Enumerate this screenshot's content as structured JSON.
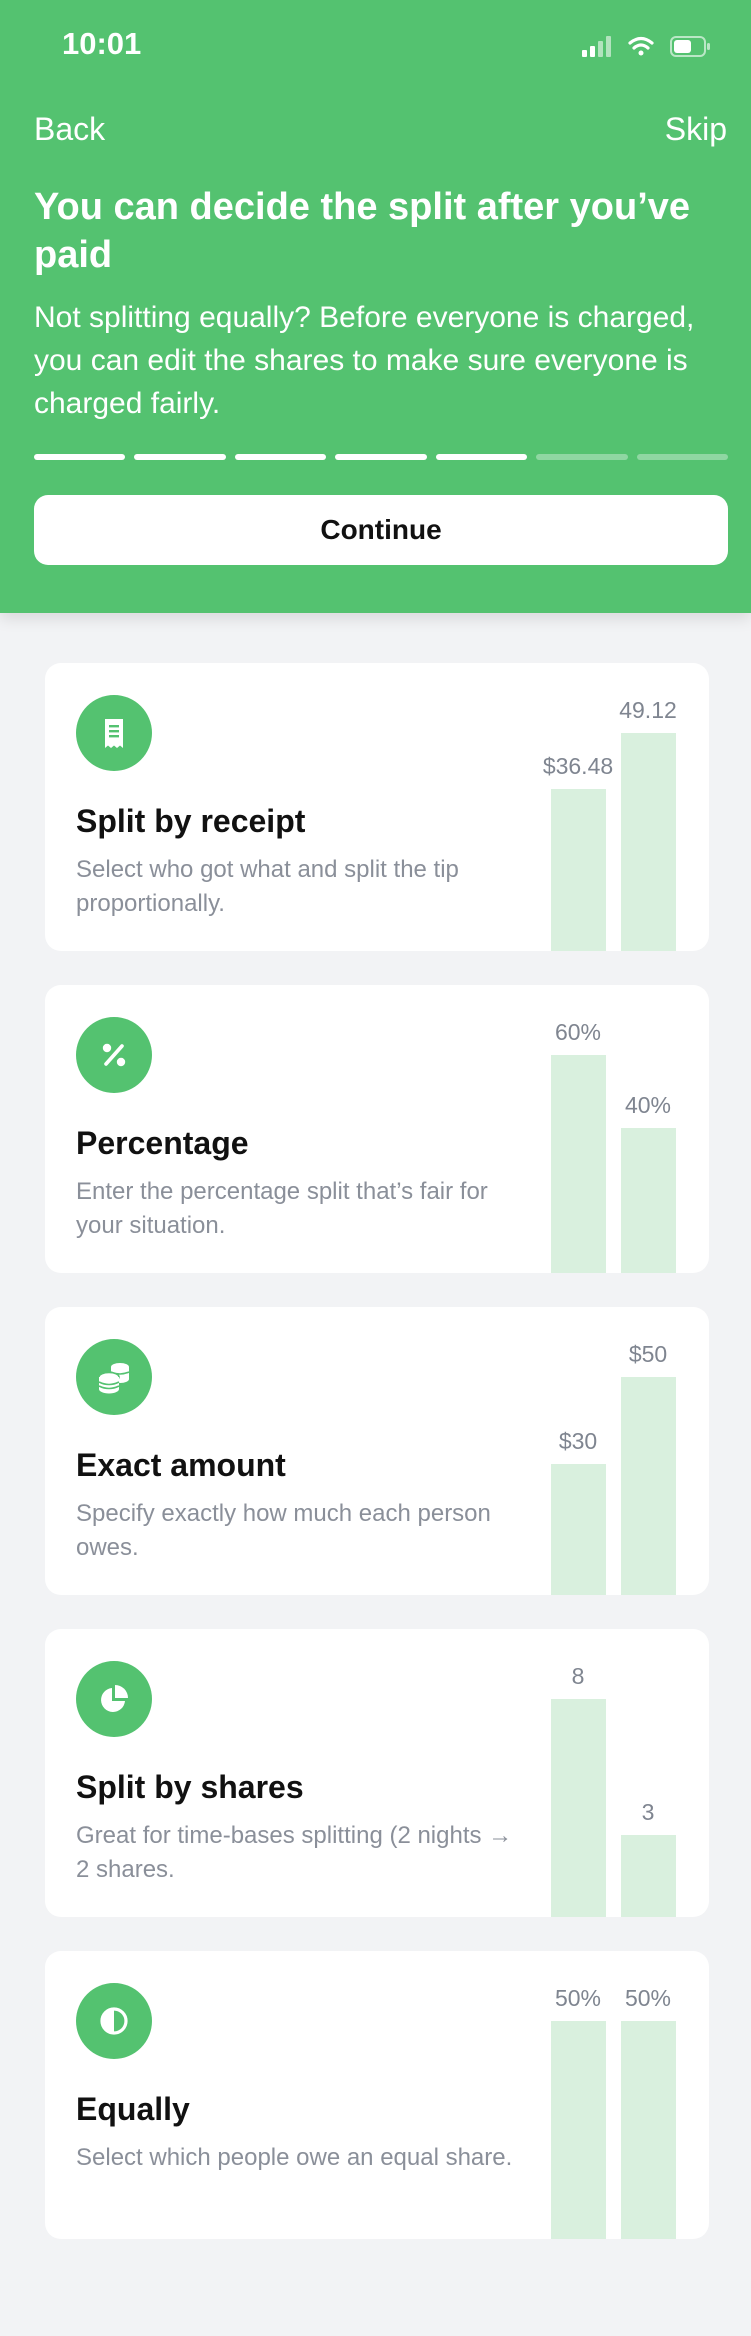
{
  "status_bar": {
    "time": "10:01"
  },
  "nav": {
    "back": "Back",
    "skip": "Skip"
  },
  "header": {
    "title": "You can decide the split after you’ve paid",
    "subtitle": "Not splitting equally? Before everyone is charged, you can edit the shares to make sure everyone is charged fairly."
  },
  "progress": {
    "total_steps": 7,
    "completed_steps": 5
  },
  "continue_label": "Continue",
  "colors": {
    "brand_green": "#54c270",
    "bar_fill": "#d9f0de",
    "background": "#f2f3f5"
  },
  "options": [
    {
      "icon": "receipt-icon",
      "title": "Split by receipt",
      "description": "Select who got what and split the tip proportionally.",
      "bars": [
        {
          "label": "$36.48",
          "value": 36.48
        },
        {
          "label": "49.12",
          "value": 49.12
        }
      ]
    },
    {
      "icon": "percent-icon",
      "title": "Percentage",
      "description": "Enter the percentage split that’s fair for your situation.",
      "bars": [
        {
          "label": "60%",
          "value": 60
        },
        {
          "label": "40%",
          "value": 40
        }
      ]
    },
    {
      "icon": "coins-icon",
      "title": "Exact amount",
      "description": "Specify exactly how much each person owes.",
      "bars": [
        {
          "label": "$30",
          "value": 30
        },
        {
          "label": "$50",
          "value": 50
        }
      ]
    },
    {
      "icon": "pie-chart-icon",
      "title": "Split by shares",
      "description": "Great for time-bases splitting (2 nights → 2 shares.",
      "bars": [
        {
          "label": "8",
          "value": 8
        },
        {
          "label": "3",
          "value": 3
        }
      ]
    },
    {
      "icon": "half-circle-icon",
      "title": "Equally",
      "description": "Select which people owe an equal share.",
      "bars": [
        {
          "label": "50%",
          "value": 50
        },
        {
          "label": "50%",
          "value": 50
        }
      ]
    }
  ]
}
